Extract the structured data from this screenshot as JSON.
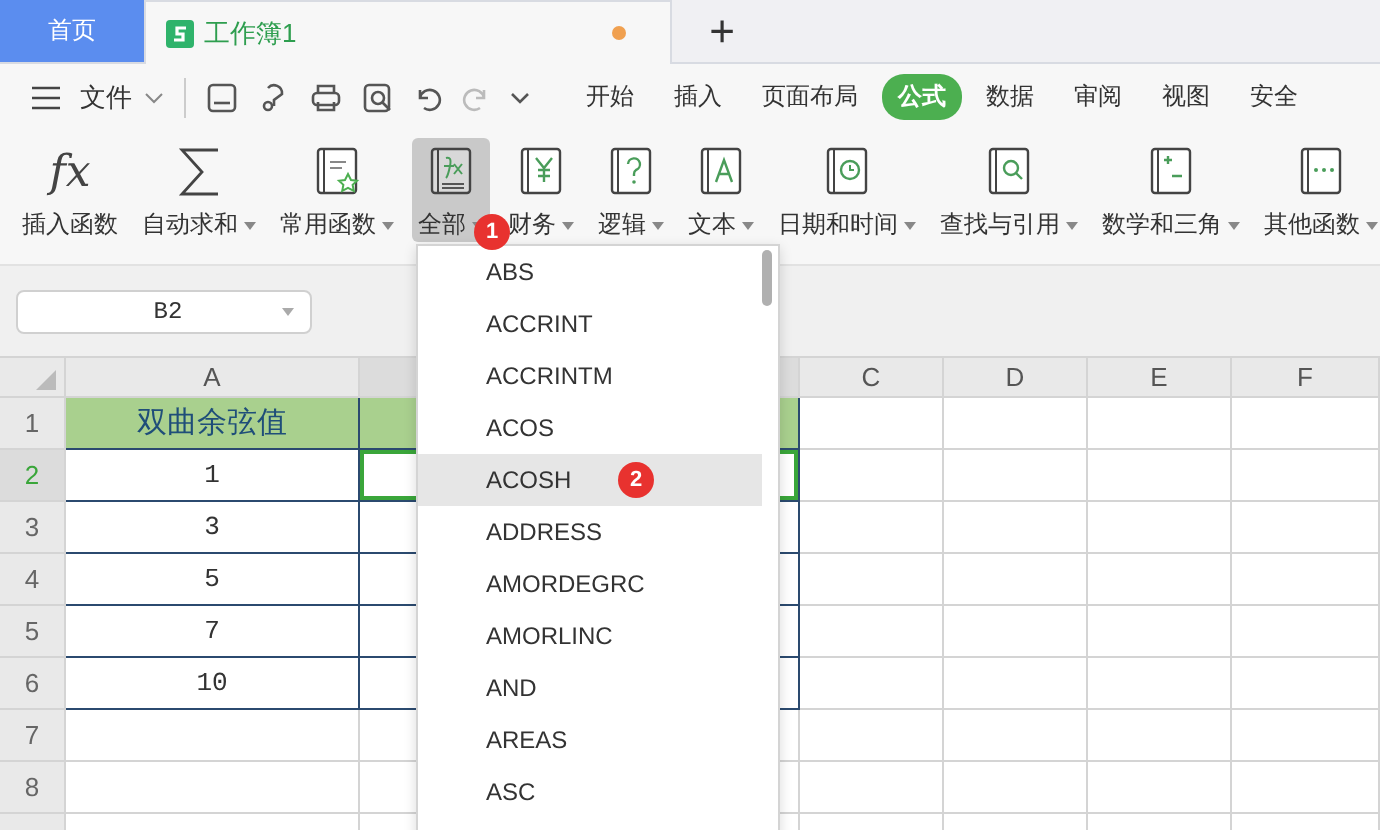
{
  "tabs": [
    {
      "label": "首页",
      "kind": "home",
      "selected": false
    },
    {
      "label": "工作簿1",
      "kind": "sheet",
      "selected": true,
      "unsaved": true
    }
  ],
  "new_tab": "+",
  "menu": {
    "file": "文件",
    "items": [
      {
        "label": "开始",
        "selected": false
      },
      {
        "label": "插入",
        "selected": false
      },
      {
        "label": "页面布局",
        "selected": false
      },
      {
        "label": "公式",
        "selected": true
      },
      {
        "label": "数据",
        "selected": false
      },
      {
        "label": "审阅",
        "selected": false
      },
      {
        "label": "视图",
        "selected": false
      },
      {
        "label": "安全",
        "selected": false
      }
    ]
  },
  "ribbon": [
    {
      "label": "插入函数",
      "kind": "fx",
      "icon_text": "fx",
      "dropdown": false,
      "selected": false
    },
    {
      "label": "自动求和",
      "kind": "sum",
      "dropdown": true,
      "selected": false
    },
    {
      "label": "常用函数",
      "kind": "star",
      "dropdown": true,
      "selected": false
    },
    {
      "label": "全部",
      "kind": "all",
      "dropdown": true,
      "selected": true,
      "callout": "1"
    },
    {
      "label": "财务",
      "kind": "yen",
      "dropdown": true,
      "selected": false
    },
    {
      "label": "逻辑",
      "kind": "question",
      "dropdown": true,
      "selected": false
    },
    {
      "label": "文本",
      "kind": "text",
      "dropdown": true,
      "selected": false
    },
    {
      "label": "日期和时间",
      "kind": "clock",
      "dropdown": true,
      "selected": false
    },
    {
      "label": "查找与引用",
      "kind": "search",
      "dropdown": true,
      "selected": false
    },
    {
      "label": "数学和三角",
      "kind": "math",
      "dropdown": true,
      "selected": false
    },
    {
      "label": "其他函数",
      "kind": "more",
      "dropdown": true,
      "selected": false
    }
  ],
  "name_box": "B2",
  "columns": [
    {
      "label": "A",
      "selected": false
    },
    {
      "selected": true
    },
    {
      "label": "C",
      "selected": false
    },
    {
      "label": "D",
      "selected": false
    },
    {
      "label": "E",
      "selected": false
    },
    {
      "label": "F",
      "selected": false
    }
  ],
  "rows": [
    {
      "number": "1",
      "kind": "header",
      "selected": false,
      "cells": [
        "双曲余弦值"
      ]
    },
    {
      "number": "2",
      "kind": "table",
      "selected": true,
      "cells": [
        "1"
      ]
    },
    {
      "number": "3",
      "kind": "table",
      "selected": false,
      "cells": [
        "3"
      ]
    },
    {
      "number": "4",
      "kind": "table",
      "selected": false,
      "cells": [
        "5"
      ]
    },
    {
      "number": "5",
      "kind": "table",
      "selected": false,
      "cells": [
        "7"
      ]
    },
    {
      "number": "6",
      "kind": "table",
      "selected": false,
      "cells": [
        "10"
      ]
    },
    {
      "number": "7",
      "kind": "plain",
      "selected": false,
      "cells": []
    },
    {
      "number": "8",
      "kind": "plain",
      "selected": false,
      "cells": []
    }
  ],
  "dropdown": {
    "items": [
      {
        "label": "ABS",
        "selected": false
      },
      {
        "label": "ACCRINT",
        "selected": false
      },
      {
        "label": "ACCRINTM",
        "selected": false
      },
      {
        "label": "ACOS",
        "selected": false
      },
      {
        "label": "ACOSH",
        "selected": true,
        "callout": "2"
      },
      {
        "label": "ADDRESS",
        "selected": false
      },
      {
        "label": "AMORDEGRC",
        "selected": false
      },
      {
        "label": "AMORLINC",
        "selected": false
      },
      {
        "label": "AND",
        "selected": false
      },
      {
        "label": "AREAS",
        "selected": false
      },
      {
        "label": "ASC",
        "selected": false
      }
    ]
  }
}
